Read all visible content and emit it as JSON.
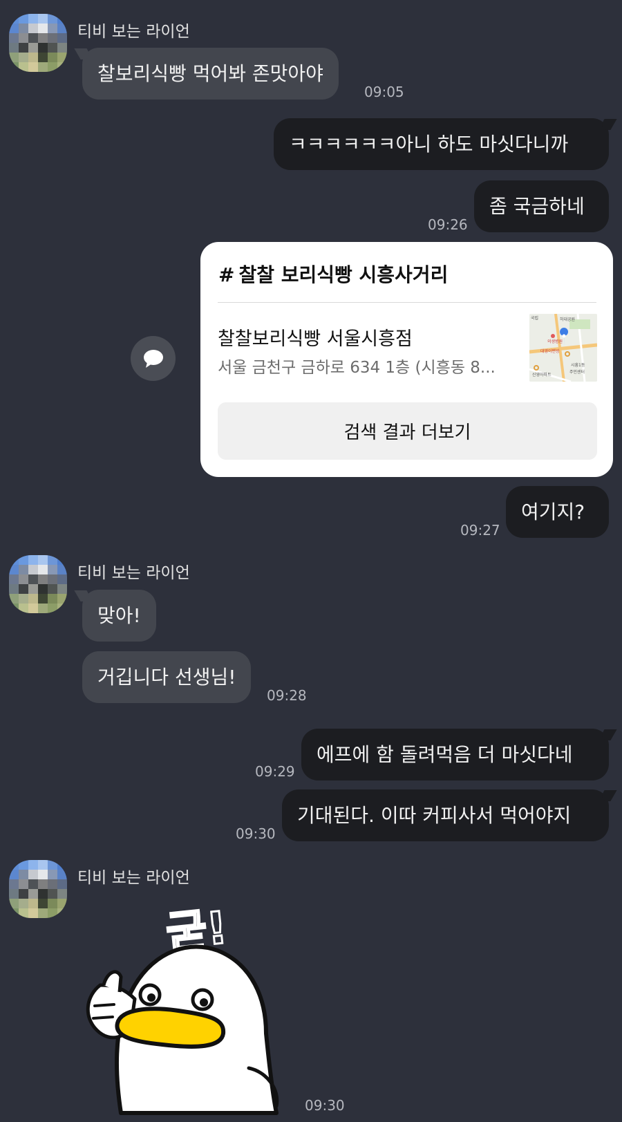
{
  "sender_name": "티비 보는 라이언",
  "messages": {
    "m1": {
      "text": "찰보리식빵 먹어봐 존맛아야",
      "time": "09:05"
    },
    "m2": {
      "text": "ㅋㅋㅋㅋㅋㅋ아니 하도 마싯다니까"
    },
    "m3": {
      "text": "좀 국금하네",
      "time": "09:26"
    },
    "m4": {
      "text": "여기지?",
      "time": "09:27"
    },
    "m5": {
      "text": "맞아!"
    },
    "m6": {
      "text": "거깁니다 선생님!",
      "time": "09:28"
    },
    "m7": {
      "text": "에프에 함 돌려먹음 더 마싯다네",
      "time": "09:29"
    },
    "m8": {
      "text": "기대된다. 이따 커피사서 먹어야지",
      "time": "09:30"
    },
    "m9": {
      "time": "09:30"
    }
  },
  "search_card": {
    "title": "찰찰 보리식빵 시흥사거리",
    "hash": "#",
    "place_name": "찰찰보리식빵 서울시흥점",
    "address": "서울 금천구 금하로 634 1층 (시흥동 8...",
    "more_label": "검색 결과 더보기",
    "map_labels": {
      "a": "국립",
      "b": "허대공원",
      "c": "의생병원",
      "d": "대영이편방",
      "e": "시흥1동",
      "f": "신영아파트",
      "g": "주민센터"
    }
  },
  "sticker": {
    "text": "굳!",
    "icon": "duck-thumbs-up-sticker"
  },
  "colors": {
    "background": "#2d303b",
    "incoming_bubble": "#43464e",
    "outgoing_bubble": "#1c1d21",
    "beak": "#ffd200"
  }
}
